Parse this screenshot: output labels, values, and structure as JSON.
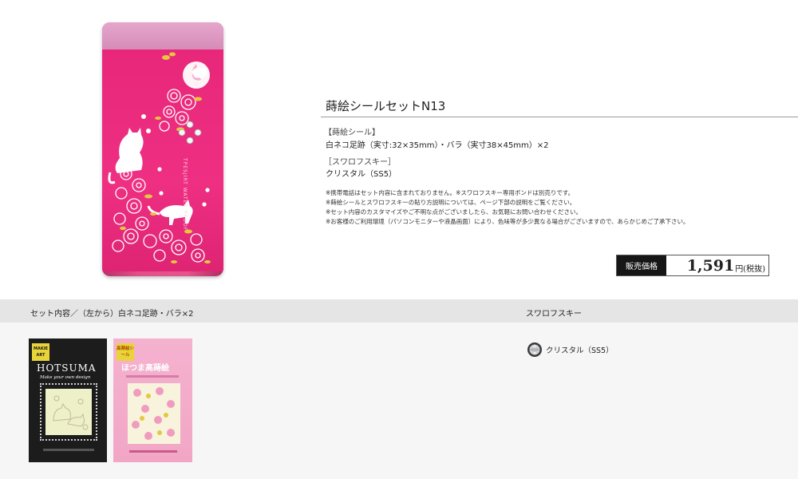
{
  "product": {
    "title": "蒔絵シールセットN13",
    "section1_head": "【蒔絵シール】",
    "section1_body": "白ネコ足跡（実寸:32×35mm）・バラ（実寸38×45mm）×2",
    "section2_head": "［スワロフスキー］",
    "section2_body": "クリスタル（SS5）",
    "notes": [
      "※携帯電話はセット内容に含まれておりません。※スワロフスキー専用ボンドは別売りです。",
      "※蒔絵シールとスワロフスキーの貼り方説明については、ページ下部の説明をご覧ください。",
      "※セット内容のカスタマイズやご不明な点がございましたら、お気軽にお問い合わせください。",
      "※お客様のご利用環境（パソコンモニターや液晶画面）により、色味等が多少異なる場合がございますので、あらかじめご了承下さい。"
    ]
  },
  "phone": {
    "side_text": "TPESJIRT WATER PROOF"
  },
  "price": {
    "label": "販売価格",
    "value": "1,591",
    "unit": "円(税抜)"
  },
  "lower": {
    "set_contents_label": "セット内容／（左から）白ネコ足跡・バラ×2",
    "swarovski_label": "スワロフスキー",
    "crystal_label": "クリスタル（SS5）"
  },
  "package1": {
    "badge": "MAKIE ART",
    "brand": "HOTSUMA",
    "tagline": "Make your own design"
  },
  "package2": {
    "badge": "高蒔絵シール",
    "title": "ほつま高蒔絵"
  },
  "colors": {
    "phone_pink": "#e8277a",
    "band_gray": "#e5e5e5",
    "price_label_bg": "#161616"
  }
}
